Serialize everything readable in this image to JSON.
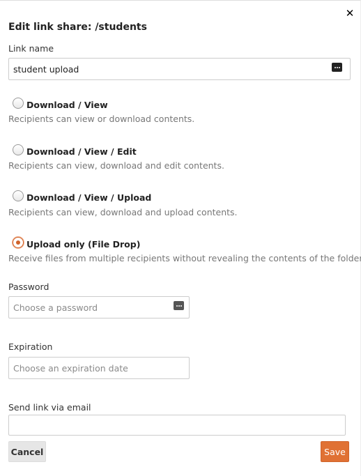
{
  "dialog": {
    "title": "Edit link share: /students",
    "close_icon": "close-icon"
  },
  "link_name": {
    "label": "Link name",
    "value": "student upload",
    "icon": "keyboard-icon"
  },
  "permissions": [
    {
      "label": "Download / View",
      "description": "Recipients can view or download contents.",
      "checked": false
    },
    {
      "label": "Download / View / Edit",
      "description": "Recipients can view, download and edit contents.",
      "checked": false
    },
    {
      "label": "Download / View / Upload",
      "description": "Recipients can view, download and upload contents.",
      "checked": false
    },
    {
      "label": "Upload only (File Drop)",
      "description": "Receive files from multiple recipients without revealing the contents of the folder.",
      "checked": true
    }
  ],
  "password": {
    "label": "Password",
    "placeholder": "Choose a password",
    "value": "",
    "icon": "keyboard-icon"
  },
  "expiration": {
    "label": "Expiration",
    "placeholder": "Choose an expiration date",
    "value": ""
  },
  "email": {
    "label": "Send link via email",
    "value": ""
  },
  "buttons": {
    "cancel": "Cancel",
    "save": "Save"
  },
  "colors": {
    "accent": "#e07134",
    "accent_border": "#d0632b"
  }
}
